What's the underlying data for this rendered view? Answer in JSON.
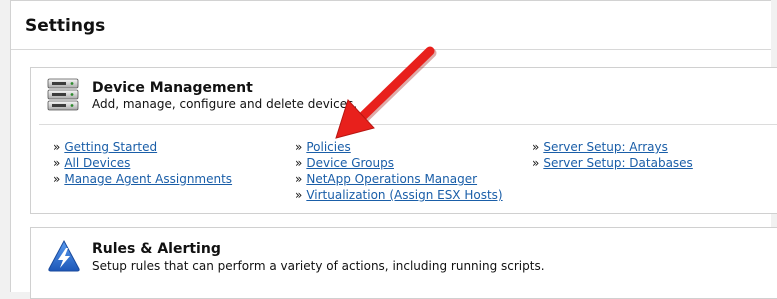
{
  "page": {
    "title": "Settings"
  },
  "device_management": {
    "name": "Device Management",
    "description": "Add, manage, configure and delete devices.",
    "icon": "server-rack-icon",
    "bullet": "»",
    "col1": [
      "Getting Started",
      "All Devices",
      "Manage Agent Assignments"
    ],
    "col2": [
      "Policies",
      "Device Groups",
      "NetApp Operations Manager",
      "Virtualization (Assign ESX Hosts)"
    ],
    "col3": [
      "Server Setup: Arrays",
      "Server Setup: Databases"
    ]
  },
  "rules_alerting": {
    "name": "Rules & Alerting",
    "description": "Setup rules that can perform a variety of actions, including running scripts.",
    "icon": "lightning-triangle-icon"
  },
  "annotation": {
    "color": "#e8201c",
    "icon": "red-arrow-annotation"
  },
  "colors": {
    "link": "#1a5ea8",
    "icon_blue": "#2d6fcf"
  }
}
